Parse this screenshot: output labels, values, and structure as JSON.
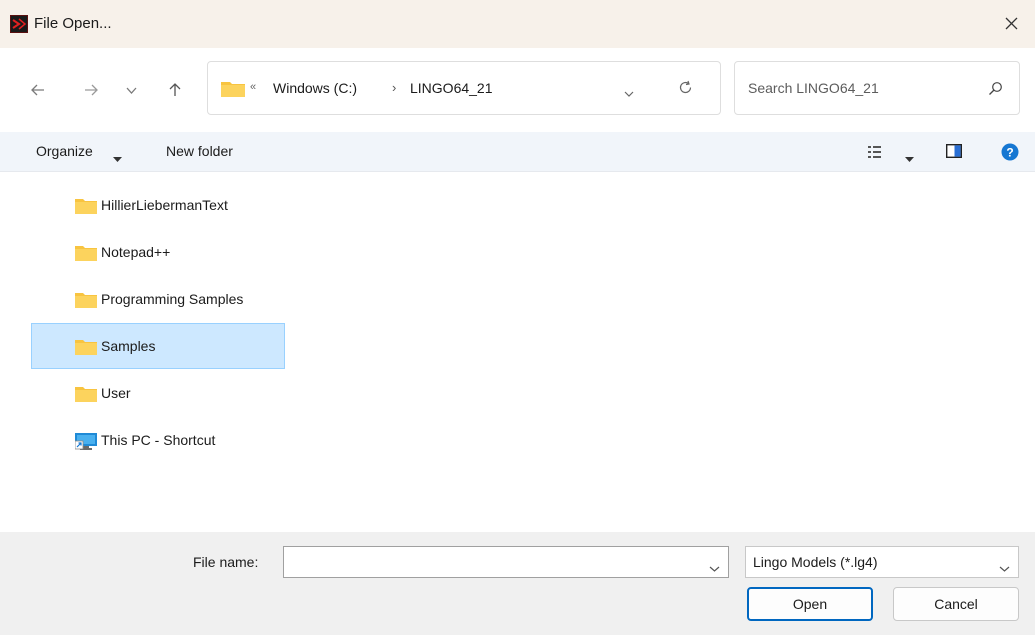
{
  "window": {
    "title": "File Open...",
    "app_icon": "lingo-app-icon",
    "close_icon": "close-icon"
  },
  "navigation": {
    "back_icon": "arrow-left-icon",
    "forward_icon": "arrow-right-icon",
    "recent_icon": "chevron-down-icon",
    "up_icon": "arrow-up-icon",
    "address": {
      "overflow_glyph": "«",
      "segments": [
        "Windows (C:)",
        "LINGO64_21"
      ],
      "separator": "›"
    },
    "search": {
      "placeholder": "Search LINGO64_21"
    }
  },
  "toolbar": {
    "organize_label": "Organize",
    "new_folder_label": "New folder"
  },
  "files": {
    "items": [
      {
        "name": "HillierLiebermanText",
        "icon": "folder-icon",
        "selected": false
      },
      {
        "name": "Notepad++",
        "icon": "folder-icon",
        "selected": false
      },
      {
        "name": "Programming Samples",
        "icon": "folder-icon",
        "selected": false
      },
      {
        "name": "Samples",
        "icon": "folder-icon",
        "selected": true
      },
      {
        "name": "User",
        "icon": "folder-icon",
        "selected": false
      },
      {
        "name": "This PC - Shortcut",
        "icon": "pc-shortcut-icon",
        "selected": false
      }
    ]
  },
  "footer": {
    "file_name_label": "File name:",
    "file_name_value": "",
    "file_type_value": "Lingo Models (*.lg4)",
    "open_label": "Open",
    "cancel_label": "Cancel"
  },
  "colors": {
    "accent": "#0067c0",
    "selection_bg": "#cde8ff",
    "folder": "#f8c440",
    "titlebar_bg": "#f7f1ea",
    "help_blue": "#1677d2"
  }
}
